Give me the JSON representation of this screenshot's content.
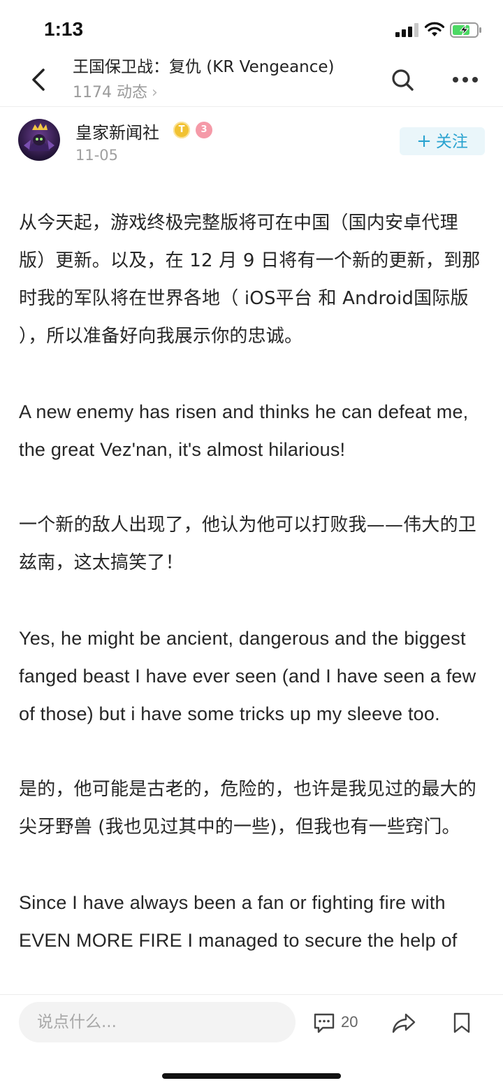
{
  "status_bar": {
    "time": "1:13"
  },
  "header": {
    "title": "王国保卫战：复仇 (KR Vengeance)",
    "subtitle": "1174 动态",
    "chevron": "›"
  },
  "post": {
    "author": "皇家新闻社",
    "badge_t": "T",
    "badge_level": "3",
    "date": "11-05",
    "follow_plus": "+",
    "follow_label": "关注",
    "paragraphs": [
      "从今天起，游戏终极完整版将可在中国（国内安卓代理版）更新。以及，在 12 月 9 日将有一个新的更新，到那时我的军队将在世界各地（ iOS平台 和 Android国际版 ），所以准备好向我展示你的忠诚。",
      "A new enemy has risen and thinks he can defeat me, the great Vez'nan, it's almost hilarious!",
      "一个新的敌人出现了，他认为他可以打败我——伟大的卫兹南，这太搞笑了！",
      "Yes, he might be ancient, dangerous and the biggest fanged beast I have ever seen (and I have seen a few of those) but i have some tricks up my sleeve too.",
      "是的，他可能是古老的，危险的，也许是我见过的最大的尖牙野兽 (我也见过其中的一些)，但我也有一些窍门。",
      "Since I have always been a fan or fighting fire with EVEN MORE FIRE I managed to secure the help of"
    ]
  },
  "bottom_bar": {
    "comment_placeholder": "说点什么...",
    "comment_count": "20"
  },
  "icons": {
    "back": "chevron-left-icon",
    "search": "search-icon",
    "more": "more-dots-icon",
    "comment": "comment-icon",
    "share": "share-icon",
    "bookmark": "bookmark-icon"
  },
  "colors": {
    "accent": "#2aa3d0",
    "follow_bg": "#eaf6fa",
    "battery": "#4cd964"
  }
}
